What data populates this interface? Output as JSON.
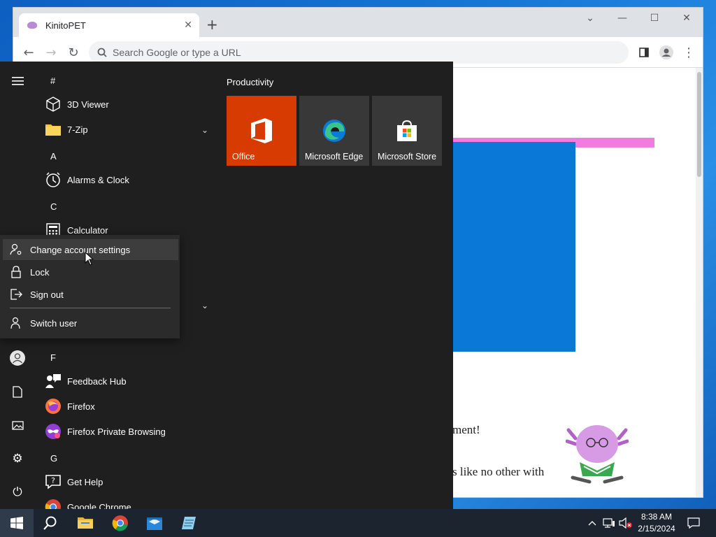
{
  "browser": {
    "tab_title": "KinitoPET",
    "omnibox_placeholder": "Search Google or type a URL",
    "page_text_1": "ment!",
    "page_text_2": "s like no other with"
  },
  "start_menu": {
    "tiles_group": "Productivity",
    "tiles": [
      {
        "label": "Office",
        "color": "#d83b01"
      },
      {
        "label": "Microsoft Edge",
        "color": "#383838"
      },
      {
        "label": "Microsoft Store",
        "color": "#383838"
      }
    ],
    "letters": [
      "#",
      "A",
      "C",
      "F",
      "G"
    ],
    "apps": [
      {
        "label": "3D Viewer"
      },
      {
        "label": "7-Zip"
      },
      {
        "label": "Alarms & Clock"
      },
      {
        "label": "Calculator"
      },
      {
        "label": "Feedback Hub"
      },
      {
        "label": "Firefox"
      },
      {
        "label": "Firefox Private Browsing"
      },
      {
        "label": "Get Help"
      },
      {
        "label": "Google Chrome"
      }
    ]
  },
  "account_flyout": {
    "items": [
      {
        "label": "Change account settings"
      },
      {
        "label": "Lock"
      },
      {
        "label": "Sign out"
      },
      {
        "label": "Switch user"
      }
    ]
  },
  "taskbar": {
    "time": "8:38 AM",
    "date": "2/15/2024"
  }
}
